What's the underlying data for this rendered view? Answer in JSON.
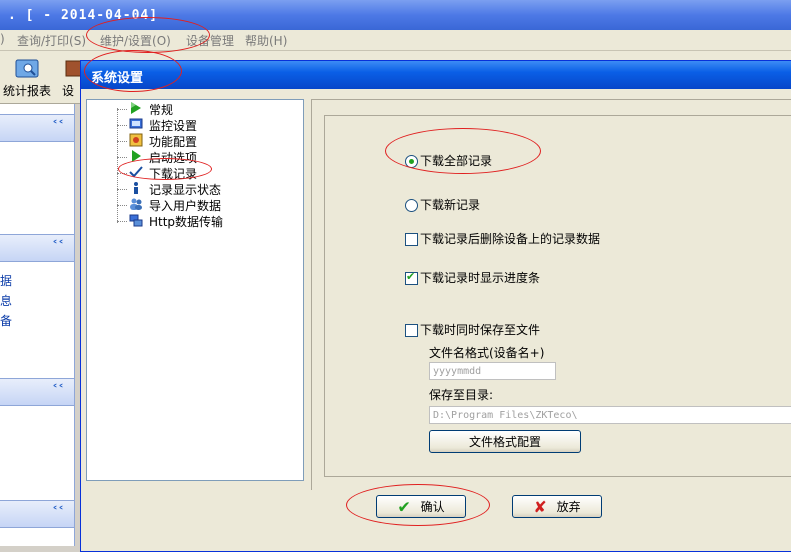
{
  "app": {
    "title": ". [ - 2014-04-04]"
  },
  "menubar": [
    {
      "label": ")"
    },
    {
      "label": "查询/打印(S)"
    },
    {
      "label": "维护/设置(O)"
    },
    {
      "label": "设备管理"
    },
    {
      "label": "帮助(H)"
    }
  ],
  "toolbar": {
    "report_label": "统计报表",
    "device_label": "设"
  },
  "sidebar": {
    "links": [
      "据",
      "息",
      "备"
    ]
  },
  "dialog": {
    "title": "系统设置",
    "tree": [
      {
        "label": "常规",
        "icon": "green-arrow-icon"
      },
      {
        "label": "监控设置",
        "icon": "monitor-icon"
      },
      {
        "label": "功能配置",
        "icon": "config-icon"
      },
      {
        "label": "启动选项",
        "icon": "play-icon"
      },
      {
        "label": "下载记录",
        "icon": "checkmark-icon"
      },
      {
        "label": "记录显示状态",
        "icon": "info-icon"
      },
      {
        "label": "导入用户数据",
        "icon": "users-icon"
      },
      {
        "label": "Http数据传输",
        "icon": "network-icon"
      }
    ],
    "options": {
      "download_all": "下载全部记录",
      "download_new": "下载新记录",
      "delete_after": "下载记录后删除设备上的记录数据",
      "show_progress": "下载记录时显示进度条",
      "save_to_file": "下载时同时保存至文件",
      "filename_format_label": "文件名格式(设备名+)",
      "filename_placeholder": "yyyymmdd",
      "save_dir_label": "保存至目录:",
      "save_dir_value": "D:\\Program Files\\ZKTeco\\",
      "format_config_button": "文件格式配置"
    },
    "state": {
      "download_mode": "all",
      "delete_after": false,
      "show_progress": true,
      "save_to_file": false
    },
    "buttons": {
      "ok": "确认",
      "cancel": "放弃"
    }
  },
  "colors": {
    "title_blue": "#0a5fe6",
    "annotation_red": "#e02020",
    "accent_green": "#21a121"
  }
}
